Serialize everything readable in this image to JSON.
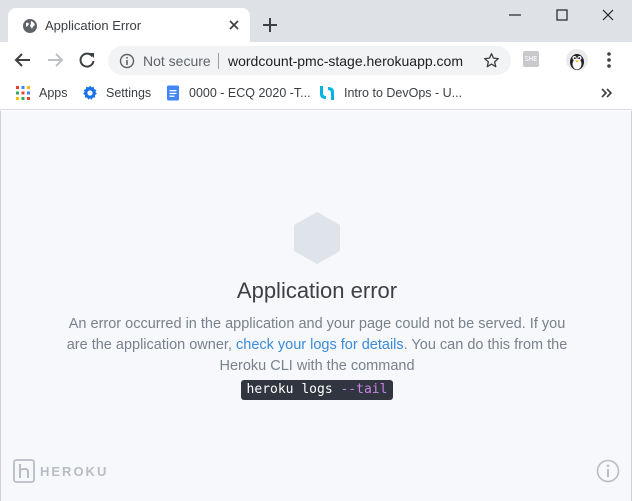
{
  "browser": {
    "tab_title": "Application Error",
    "omnibox": {
      "security_label": "Not secure",
      "url": "wordcount-pmc-stage.herokuapp.com"
    },
    "extension_label": "SHE",
    "bookmarks": [
      {
        "label": "Apps",
        "icon": "apps-grid-icon"
      },
      {
        "label": "Settings",
        "icon": "gear-icon"
      },
      {
        "label": "0000 - ECQ 2020 -T...",
        "icon": "docs-icon"
      },
      {
        "label": "Intro to DevOps - U...",
        "icon": "udacity-icon"
      }
    ]
  },
  "page": {
    "title": "Application error",
    "message_line1": "An error occurred in the application and your page could not be served. If you are the application owner,",
    "logs_link": "check your logs for details",
    "message_line2": ". You can do this from the Heroku CLI with the command",
    "command_base": "heroku logs ",
    "command_flag": "--tail",
    "brand": "HEROKU"
  },
  "colors": {
    "link": "#3a8bd8",
    "page_background": "#f7f8fb",
    "chrome_background": "#dee1e6"
  }
}
